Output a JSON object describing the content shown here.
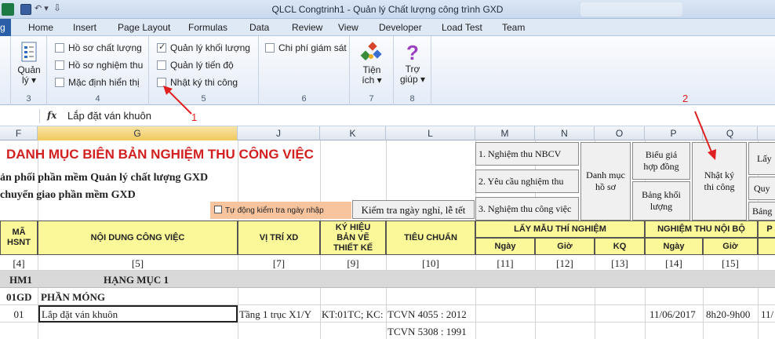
{
  "window": {
    "title": "QLCL Congtrinh1 - Quản lý Chất lượng công trình GXD"
  },
  "tabs": [
    "g",
    "Home",
    "Insert",
    "Page Layout",
    "Formulas",
    "Data",
    "Review",
    "View",
    "Developer",
    "Load Test",
    "Team"
  ],
  "ribbon": {
    "group3": {
      "btn_line1": "Quản",
      "btn_line2": "lý ▾",
      "num": "3"
    },
    "group4": {
      "items": [
        "Hồ sơ chất lượng",
        "Hồ sơ nghiệm thu",
        "Mặc định hiển thị"
      ],
      "num": "4"
    },
    "group5": {
      "items": [
        "Quản lý khối lượng",
        "Quản lý tiến độ",
        "Nhật ký thi công"
      ],
      "checked": [
        true,
        false,
        false
      ],
      "num": "5"
    },
    "group6": {
      "items": [
        "Chi phí giám sát"
      ],
      "num": "6"
    },
    "group7": {
      "btn_line1": "Tiện",
      "btn_line2": "ích ▾",
      "num": "7"
    },
    "group8": {
      "btn_line1": "Trợ",
      "btn_line2": "giúp ▾",
      "num": "8"
    },
    "annot1": "1",
    "annot2": "2"
  },
  "formula": {
    "fx": "fx",
    "value": "Lắp đặt ván khuôn"
  },
  "columns": [
    "F",
    "G",
    "J",
    "K",
    "L",
    "M",
    "N",
    "O",
    "P",
    "Q"
  ],
  "sheet": {
    "title": "DANH MỤC BIÊN BẢN NGHIỆM THU CÔNG VIỆC",
    "line1": "ản phối phần mềm Quản lý chất lượng GXD",
    "line2": "chuyển giao phần mềm GXD",
    "autocheck": "Tự động kiểm tra ngày nhập",
    "check_btn": "Kiểm tra ngày nghỉ, lễ tết",
    "menu_btns": [
      "1. Nghiệm thu NBCV",
      "2. Yêu cầu nghiệm thu",
      "3. Nghiệm thu công việc"
    ],
    "danhmuc": "Danh mục hồ sơ",
    "bieugia": "Biểu giá hợp đồng",
    "bangkl": "Bảng khối lượng",
    "nhatky": "Nhật ký thi công",
    "lay": "Lấy",
    "quy": "Quy",
    "bang": "Bảng",
    "headers": {
      "ma": "MÃ HSNT",
      "noidung": "NỘI DUNG CÔNG VIỆC",
      "vitri": "VỊ TRÍ XD",
      "kyhieu": "KÝ HIỆU BẢN VẼ THIẾT KẾ",
      "tieuchuan": "TIÊU CHUẨN",
      "laymau": "LẤY MẪU THÍ NGHIỆM",
      "ngay1": "Ngày",
      "gio1": "Giờ",
      "kq": "KQ",
      "nghiemthu": "NGHIỆM THU NỘI BỘ",
      "ngay2": "Ngày",
      "gio2": "Giờ",
      "p": "P"
    },
    "idx": [
      "[4]",
      "[5]",
      "[7]",
      "[9]",
      "[10]",
      "[11]",
      "[12]",
      "[13]",
      "[14]",
      "[15]"
    ],
    "hm_code": "HM1",
    "hm_name": "HẠNG MỤC 1",
    "gd_code": "01GD",
    "gd_name": "PHẦN MÓNG",
    "row": {
      "code": "01",
      "content": "Lắp đặt ván khuôn",
      "vitri": "Tầng 1 trục X1/Y",
      "kyhieu": "KT:01TC; KC:",
      "tc1": "TCVN 4055 : 2012",
      "ngay": "11/06/2017",
      "gio": "8h20-9h00",
      "last": "11/"
    },
    "tc2": "TCVN 5308 : 1991"
  },
  "colors": {
    "title_red": "#d21f1f",
    "header_yellow": "#fbf89a",
    "excel_green": "#217346",
    "arrow_red": "#e02020"
  }
}
